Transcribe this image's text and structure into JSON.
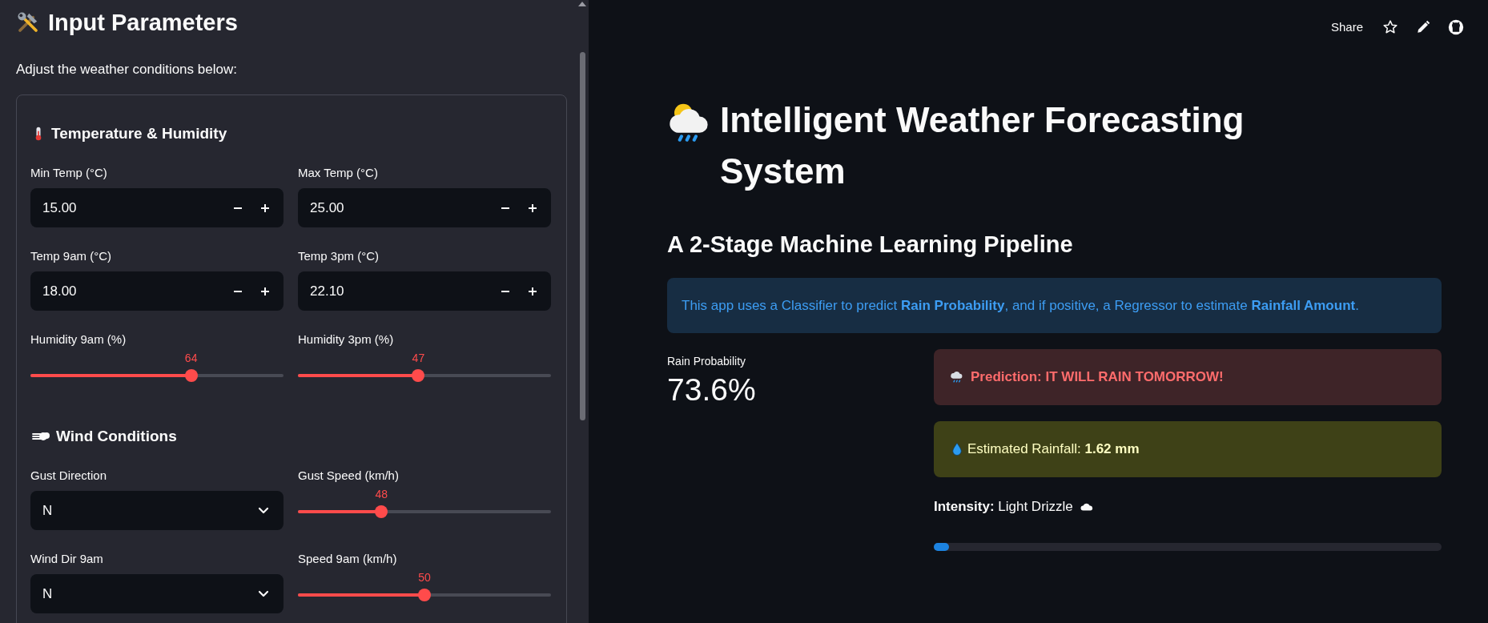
{
  "sidebar": {
    "title": "Input Parameters",
    "intro": "Adjust the weather conditions below:",
    "sections": [
      {
        "heading": "Temperature & Humidity",
        "controls": [
          {
            "kind": "number",
            "label": "Min Temp (°C)",
            "value": "15.00"
          },
          {
            "kind": "number",
            "label": "Max Temp (°C)",
            "value": "25.00"
          },
          {
            "kind": "number",
            "label": "Temp 9am (°C)",
            "value": "18.00"
          },
          {
            "kind": "number",
            "label": "Temp 3pm (°C)",
            "value": "22.10"
          },
          {
            "kind": "slider",
            "label": "Humidity 9am (%)",
            "reading": "64",
            "level": 0.635
          },
          {
            "kind": "slider",
            "label": "Humidity 3pm (%)",
            "reading": "47",
            "level": 0.476
          }
        ]
      },
      {
        "heading": "Wind Conditions",
        "controls": [
          {
            "kind": "select",
            "label": "Gust Direction",
            "value": "N"
          },
          {
            "kind": "slider",
            "label": "Gust Speed (km/h)",
            "reading": "48",
            "level": 0.33
          },
          {
            "kind": "select",
            "label": "Wind Dir 9am",
            "value": "N"
          },
          {
            "kind": "slider",
            "label": "Speed 9am (km/h)",
            "reading": "50",
            "level": 0.5
          }
        ]
      }
    ]
  },
  "toolbar": {
    "share": "Share"
  },
  "main": {
    "title": "Intelligent Weather Forecasting System",
    "subtitle": "A 2-Stage Machine Learning Pipeline",
    "info": "This app uses a Classifier to predict **Rain Probability**, and if positive, a Regressor to estimate **Rainfall Amount**.",
    "metric": {
      "label": "Rain Probability",
      "value": "73.6%"
    },
    "prediction": "Prediction: IT WILL RAIN TOMORROW!",
    "rainfall": "Estimated Rainfall: **1.62 mm**",
    "intensity": "**Intensity:** Light Drizzle",
    "intensity_bar": {
      "level": 0.03
    }
  }
}
